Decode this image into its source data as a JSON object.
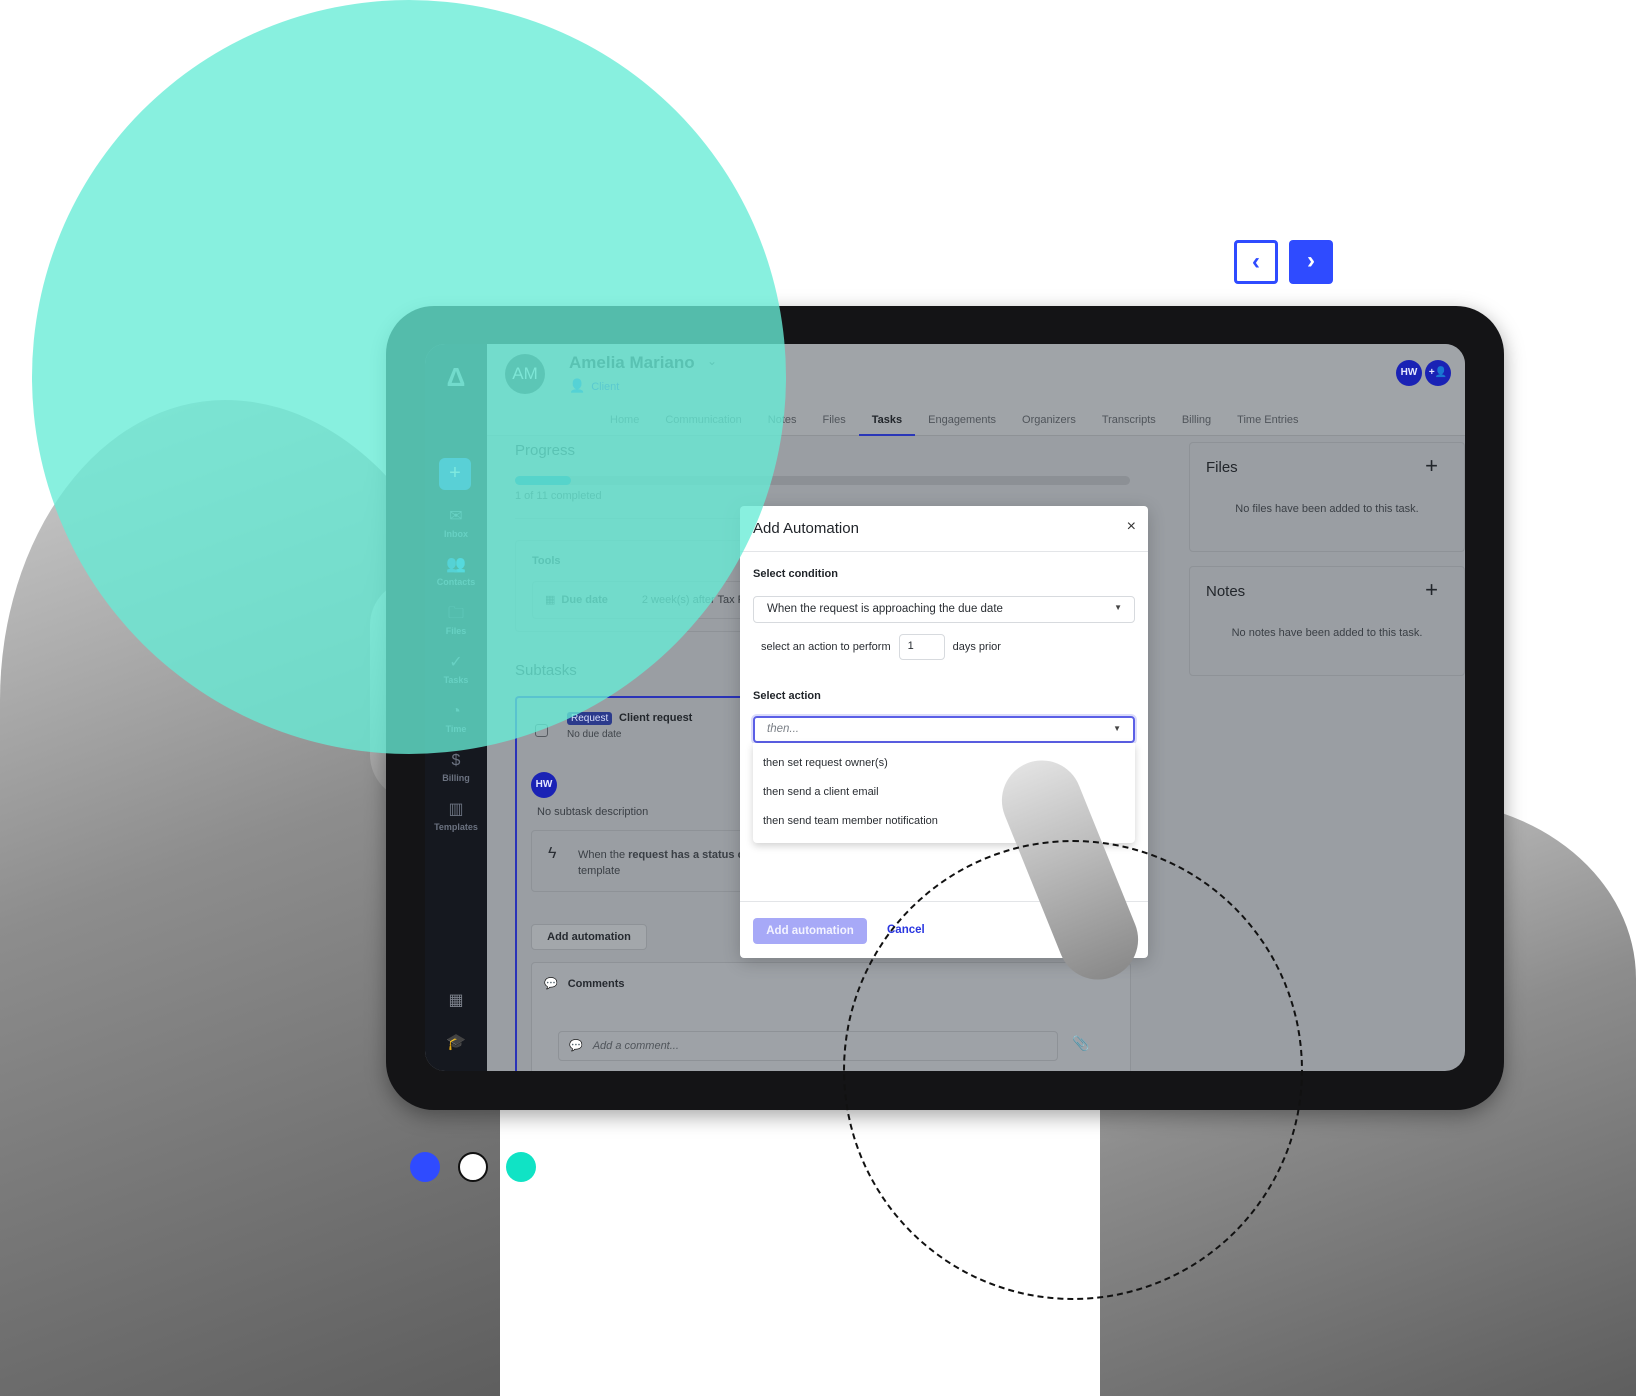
{
  "app": {
    "sidebar": {
      "new_button": "+",
      "items": [
        {
          "label": "Inbox",
          "icon": "✉"
        },
        {
          "label": "Contacts",
          "icon": "👥"
        },
        {
          "label": "Files",
          "icon": "🗀"
        },
        {
          "label": "Tasks",
          "icon": "✓"
        },
        {
          "label": "Time",
          "icon": "◔"
        },
        {
          "label": "Billing",
          "icon": "$"
        },
        {
          "label": "Templates",
          "icon": "▥"
        }
      ],
      "bottom_icons": {
        "calendar": "▦",
        "academy": "🎓"
      }
    },
    "header": {
      "avatar_initials": "AM",
      "client_name": "Amelia Mariano",
      "client_role": "Client",
      "tabs": [
        "Home",
        "Communication",
        "Notes",
        "Files",
        "Tasks",
        "Engagements",
        "Organizers",
        "Transcripts",
        "Billing",
        "Time Entries"
      ],
      "active_tab": "Tasks",
      "user_initials": "HW",
      "add_user_icon": "+👤"
    },
    "progress": {
      "title": "Progress",
      "completed": 1,
      "total": 11,
      "label": "1 of 11 completed"
    },
    "tools": {
      "title": "Tools",
      "due_date_label": "Due date",
      "due_date_value": "2 week(s) after Tax P"
    },
    "subtasks": {
      "title": "Subtasks",
      "badge": "Request",
      "name": "Client request",
      "due": "No due date",
      "assignee": "HW",
      "description": "No subtask description",
      "automation_text_pre": "When the ",
      "automation_text_bold": "request has a status o",
      "automation_text_post": "template",
      "add_automation": "Add automation",
      "comments_title": "Comments",
      "comment_placeholder": "Add a comment..."
    },
    "files_panel": {
      "title": "Files",
      "empty": "No files have been added to this task."
    },
    "notes_panel": {
      "title": "Notes",
      "empty": "No notes have been added to this task."
    }
  },
  "modal": {
    "title": "Add Automation",
    "close": "×",
    "condition_label": "Select condition",
    "condition_value": "When the request is approaching the due date",
    "days_prefix": "select an action to perform",
    "days_value": "1",
    "days_suffix": "days prior",
    "action_label": "Select action",
    "action_placeholder": "then...",
    "action_options": [
      "then set request owner(s)",
      "then send a client email",
      "then send team member notification"
    ],
    "submit": "Add automation",
    "cancel": "Cancel"
  },
  "carousel": {
    "prev": "‹",
    "next": "›",
    "dots": 3,
    "active_dot": 1,
    "colors": {
      "primary": "#2f4bff",
      "accent": "#10e3c5"
    }
  }
}
